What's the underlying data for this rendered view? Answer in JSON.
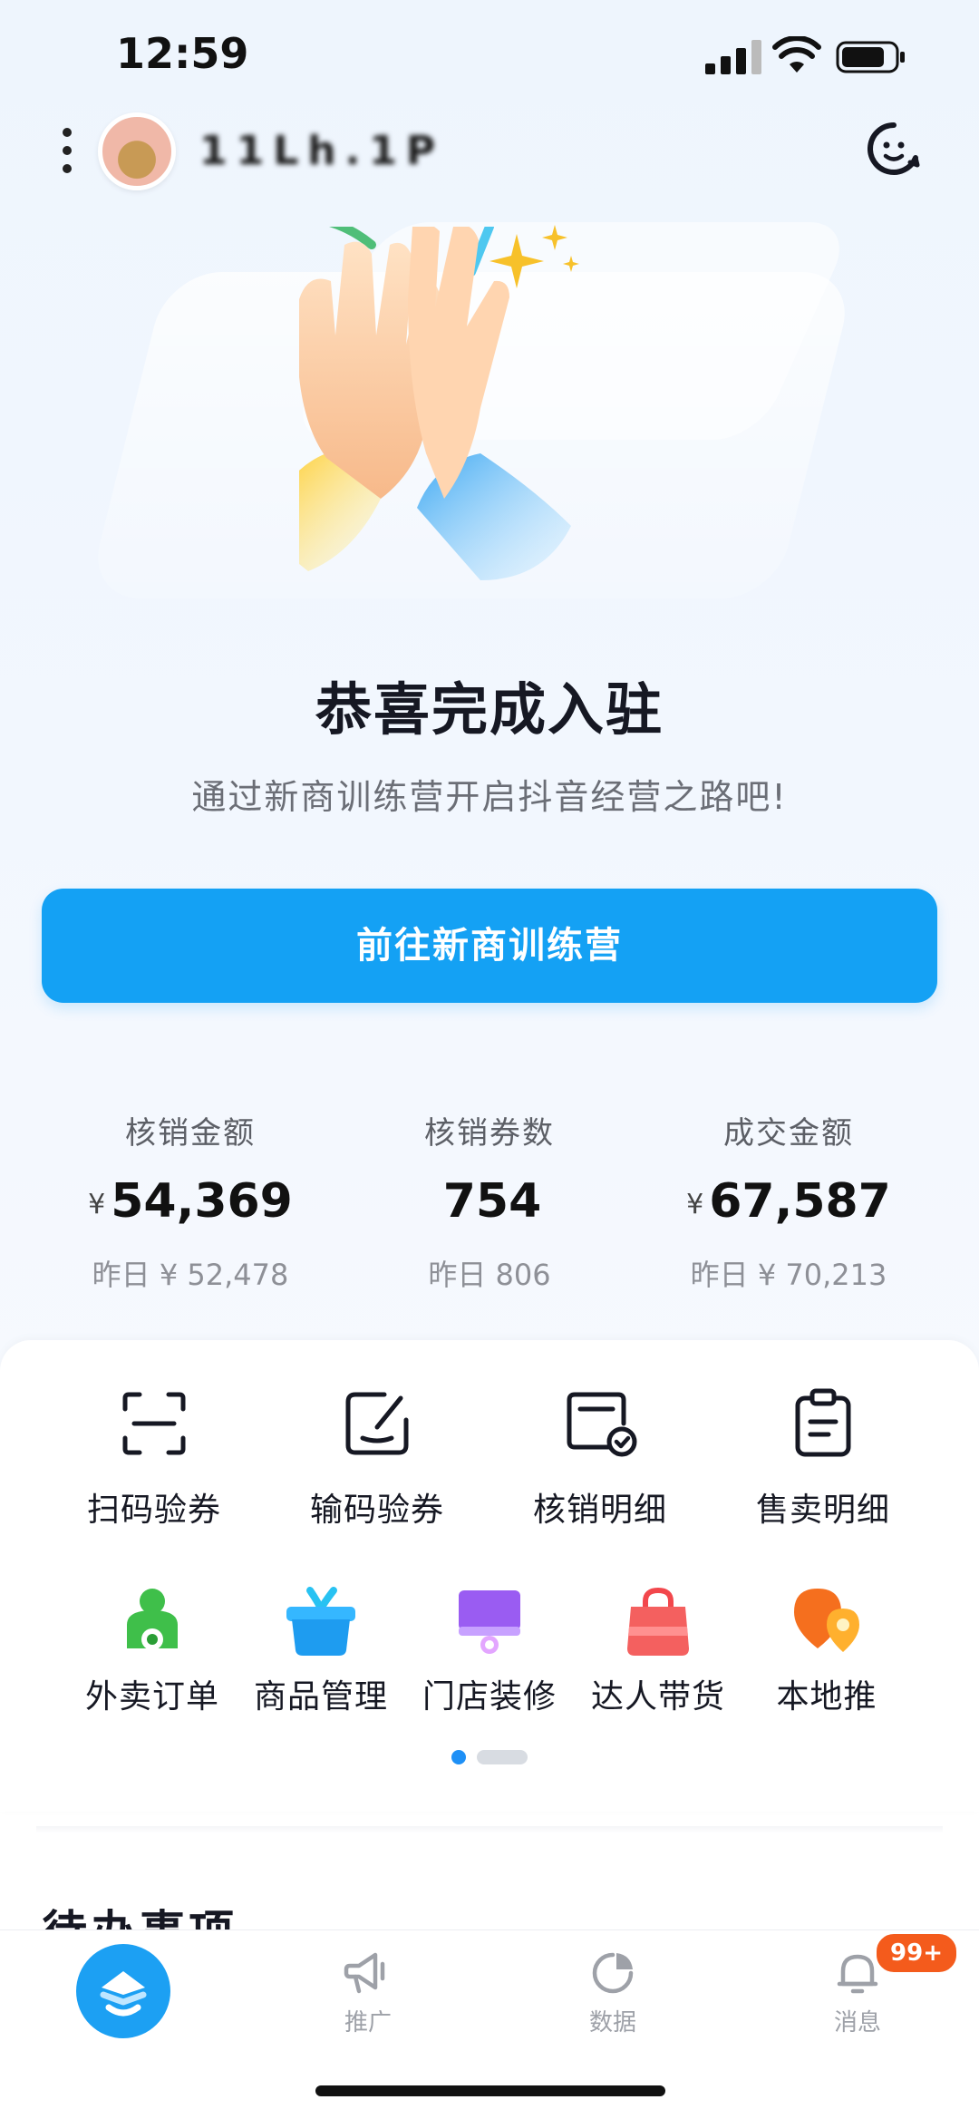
{
  "status_bar": {
    "time": "12:59"
  },
  "header": {
    "shop_name": "11Lh.1P"
  },
  "hero": {
    "title": "恭喜完成入驻",
    "subtitle": "通过新商训练营开启抖音经营之路吧!",
    "cta_label": "前往新商训练营"
  },
  "stats": [
    {
      "label": "核销金额",
      "currency": "¥",
      "value": "54,369",
      "yesterday": "昨日 ¥ 52,478"
    },
    {
      "label": "核销券数",
      "currency": "",
      "value": "754",
      "yesterday": "昨日 806"
    },
    {
      "label": "成交金额",
      "currency": "¥",
      "value": "67,587",
      "yesterday": "昨日 ¥ 70,213"
    }
  ],
  "tools": [
    {
      "label": "扫码验券",
      "icon": "scan-icon"
    },
    {
      "label": "输码验券",
      "icon": "edit-code-icon"
    },
    {
      "label": "核销明细",
      "icon": "verified-card-icon"
    },
    {
      "label": "售卖明细",
      "icon": "clipboard-icon"
    }
  ],
  "services": [
    {
      "label": "外卖订单",
      "icon": "scooter-icon",
      "color": "#3fbf4a"
    },
    {
      "label": "商品管理",
      "icon": "basket-icon",
      "color": "#1e9cf0"
    },
    {
      "label": "门店装修",
      "icon": "store-decor-icon",
      "color": "#9a5cf2"
    },
    {
      "label": "达人带货",
      "icon": "shopping-bag-icon",
      "color": "#f2474c"
    },
    {
      "label": "本地推",
      "icon": "location-promo-icon",
      "color": "#f56f1e"
    }
  ],
  "pager": {
    "current": 1,
    "total": 2
  },
  "todo": {
    "title": "待办事项"
  },
  "tabbar": {
    "items": [
      {
        "label": "",
        "icon": "home-logo-icon"
      },
      {
        "label": "推广",
        "icon": "megaphone-icon"
      },
      {
        "label": "数据",
        "icon": "pie-chart-icon"
      },
      {
        "label": "消息",
        "icon": "bell-icon"
      }
    ],
    "badge": "99+"
  },
  "colors": {
    "primary": "#14a1f4",
    "badge": "#f45b1c",
    "text": "#161823",
    "muted": "#8e9097"
  }
}
